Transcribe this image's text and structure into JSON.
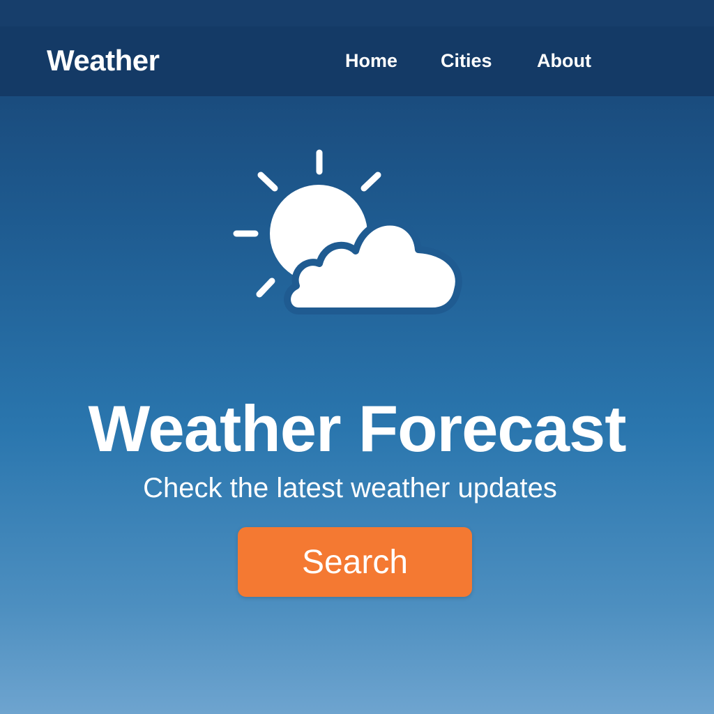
{
  "header": {
    "brand": "Weather",
    "nav": [
      {
        "label": "Home"
      },
      {
        "label": "Cities"
      },
      {
        "label": "About"
      }
    ]
  },
  "hero": {
    "icon": "partly-cloudy-icon",
    "title": "Weather Forecast",
    "subtitle": "Check the latest weather updates",
    "button_label": "Search"
  },
  "colors": {
    "navbar": "#143a66",
    "background_top": "#17406f",
    "background_bottom": "#6ea4cf",
    "button": "#f47932",
    "text": "#ffffff"
  }
}
